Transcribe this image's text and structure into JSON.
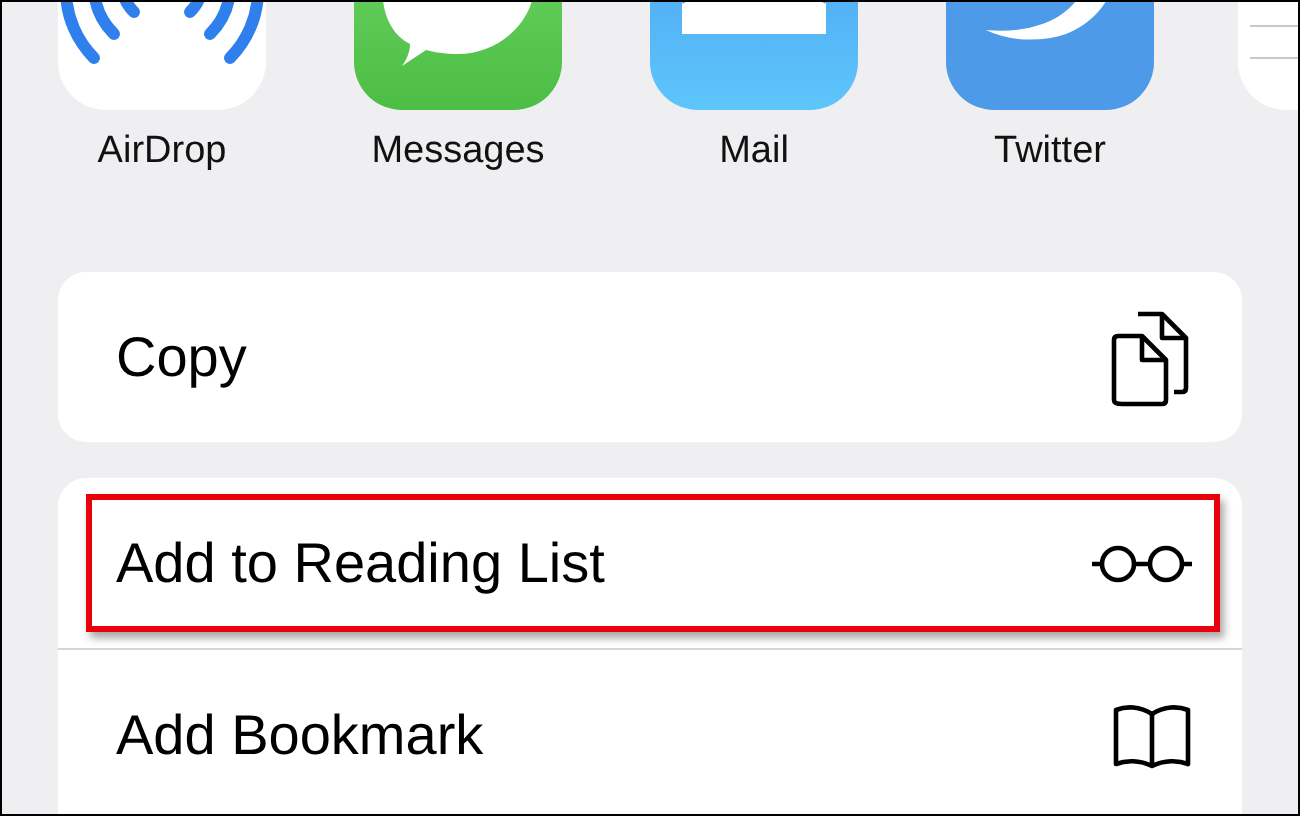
{
  "apps": [
    {
      "kind": "airdrop",
      "label": "AirDrop"
    },
    {
      "kind": "messages",
      "label": "Messages"
    },
    {
      "kind": "mail",
      "label": "Mail"
    },
    {
      "kind": "twitter",
      "label": "Twitter"
    },
    {
      "kind": "partial"
    }
  ],
  "action_groups": [
    [
      {
        "kind": "copy",
        "label": "Copy",
        "highlighted": false
      }
    ],
    [
      {
        "kind": "reading-list",
        "label": "Add to Reading List",
        "highlighted": true
      },
      {
        "kind": "bookmark",
        "label": "Add Bookmark",
        "highlighted": false
      }
    ]
  ]
}
